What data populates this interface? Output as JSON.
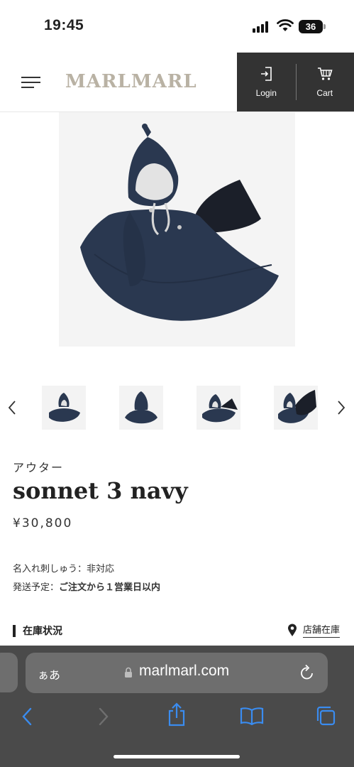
{
  "status": {
    "time": "19:45",
    "battery": "36"
  },
  "header": {
    "logo": "MARLMARL",
    "login_label": "Login",
    "cart_label": "Cart"
  },
  "product": {
    "category": "アウター",
    "title": "sonnet 3 navy",
    "price": "¥30,800",
    "embroidery_label": "名入れ刺しゅう：",
    "embroidery_value": "非対応",
    "shipping_label": "発送予定：",
    "shipping_value": "ご注文から１営業日以内",
    "stock_heading": "在庫状況",
    "store_stock_link": "店舗在庫"
  },
  "browser": {
    "aa": "ぁあ",
    "url": "marlmarl.com"
  },
  "colors": {
    "navy": "#2a3850",
    "header_dark": "#333333",
    "browser_bar": "#4a4a4a"
  }
}
